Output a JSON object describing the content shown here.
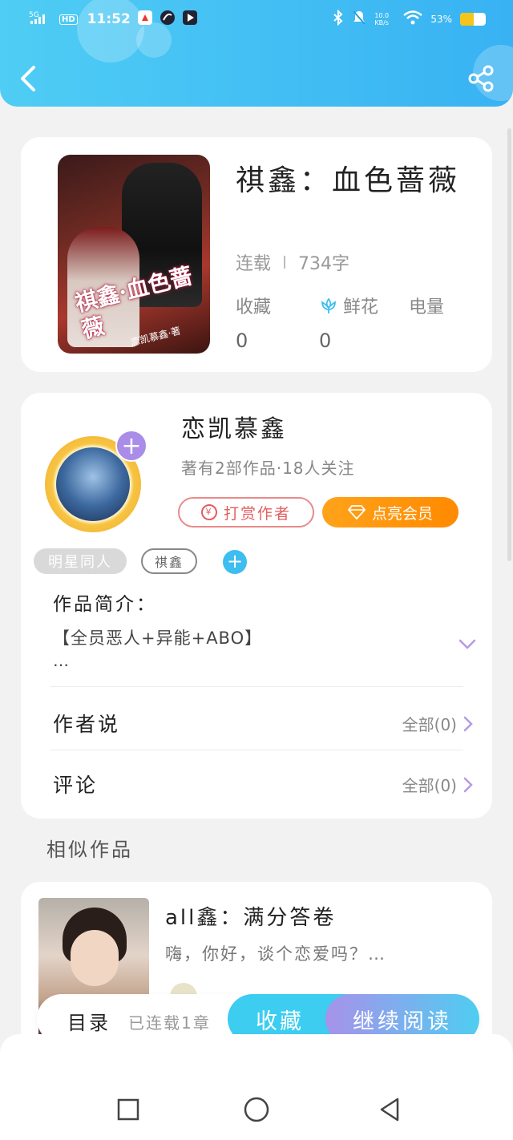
{
  "status_bar": {
    "network": "5G",
    "hd": "HD",
    "time": "11:52",
    "speed": "10.0 KB/s",
    "battery_pct": "53%",
    "battery_level": 0.53
  },
  "book": {
    "cover_title": "祺鑫·血色蔷薇",
    "cover_author": "恋凯慕鑫·著",
    "title": "祺鑫：血色蔷薇",
    "status": "连载",
    "word_count": "734字",
    "stats": [
      {
        "label": "收藏",
        "value": "0",
        "icon": ""
      },
      {
        "label": "鲜花",
        "value": "0",
        "icon": "flower-icon"
      },
      {
        "label": "电量",
        "value": "",
        "icon": ""
      }
    ]
  },
  "author": {
    "name": "恋凯慕鑫",
    "summary": "著有2部作品·18人关注",
    "tip_label": "打赏作者",
    "vip_label": "点亮会员",
    "tags": [
      "明星同人",
      "祺鑫"
    ]
  },
  "intro": {
    "label": "作品简介：",
    "text": "【全员恶人+异能+ABO】",
    "more": "…"
  },
  "rows": {
    "author_says": {
      "label": "作者说",
      "value": "全部(0)"
    },
    "comments": {
      "label": "评论",
      "value": "全部(0)"
    }
  },
  "similar": {
    "heading": "相似作品",
    "items": [
      {
        "title": "all鑫：满分答卷",
        "desc": "嗨，你好，谈个恋爱吗？…"
      }
    ]
  },
  "action_bar": {
    "toc": "目录",
    "serial": "已连载1章",
    "favorite": "收藏",
    "continue": "继续阅读"
  },
  "colors": {
    "header_start": "#4fcdf4",
    "header_end": "#38b2f3",
    "vip": "#ff9a10",
    "tip": "#e35d5d",
    "accent": "#3ccdf0"
  }
}
